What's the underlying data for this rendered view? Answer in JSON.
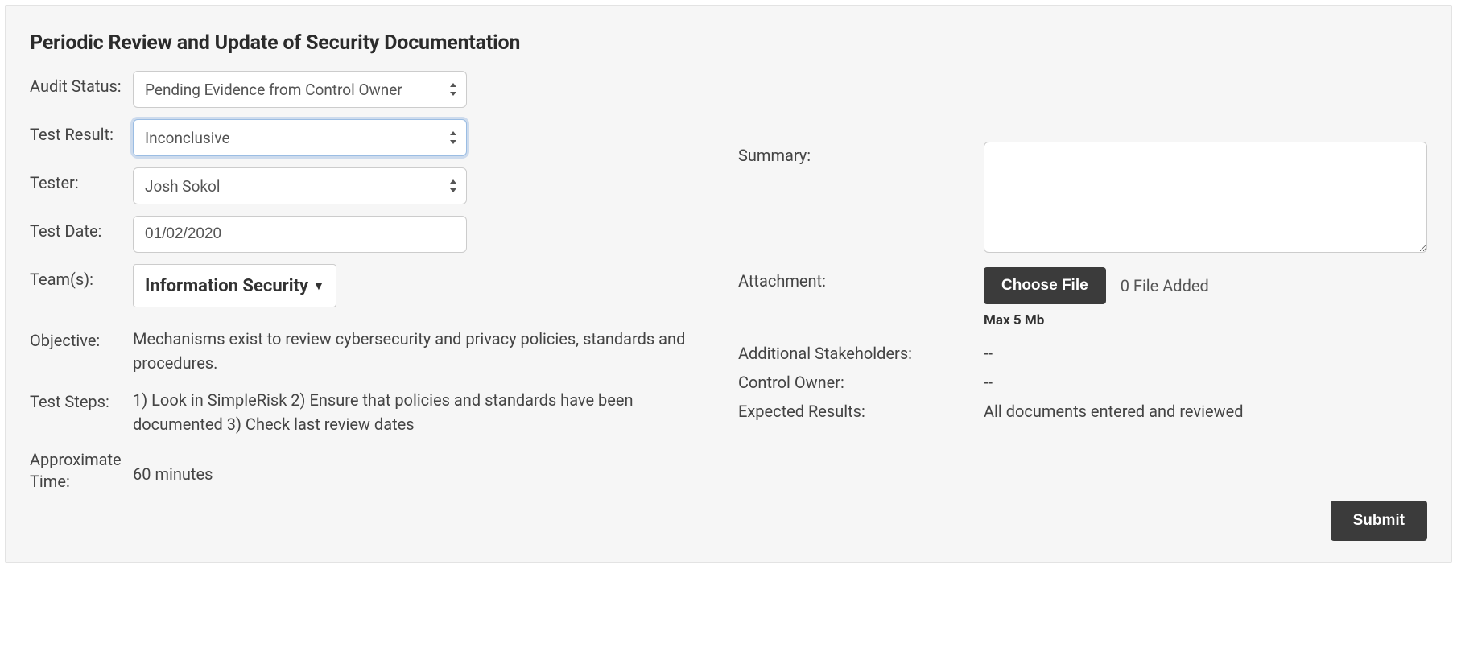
{
  "title": "Periodic Review and Update of Security Documentation",
  "left": {
    "audit_status": {
      "label": "Audit Status:",
      "value": "Pending Evidence from Control Owner"
    },
    "test_result": {
      "label": "Test Result:",
      "value": "Inconclusive"
    },
    "tester": {
      "label": "Tester:",
      "value": "Josh Sokol"
    },
    "test_date": {
      "label": "Test Date:",
      "value": "01/02/2020"
    },
    "teams": {
      "label": "Team(s):",
      "value": "Information Security"
    },
    "objective": {
      "label": "Objective:",
      "value": "Mechanisms exist to review cybersecurity and privacy policies, standards and procedures."
    },
    "test_steps": {
      "label": "Test Steps:",
      "value": "1) Look in SimpleRisk 2) Ensure that policies and standards have been documented 3) Check last review dates"
    },
    "approx_time": {
      "label": "Approximate Time:",
      "value": "60 minutes"
    }
  },
  "right": {
    "summary": {
      "label": "Summary:",
      "value": ""
    },
    "attachment": {
      "label": "Attachment:",
      "button": "Choose File",
      "status": "0 File Added",
      "max": "Max 5 Mb"
    },
    "stakeholders": {
      "label": "Additional Stakeholders:",
      "value": "--"
    },
    "control_owner": {
      "label": "Control Owner:",
      "value": "--"
    },
    "expected": {
      "label": "Expected Results:",
      "value": "All documents entered and reviewed"
    }
  },
  "submit_label": "Submit"
}
